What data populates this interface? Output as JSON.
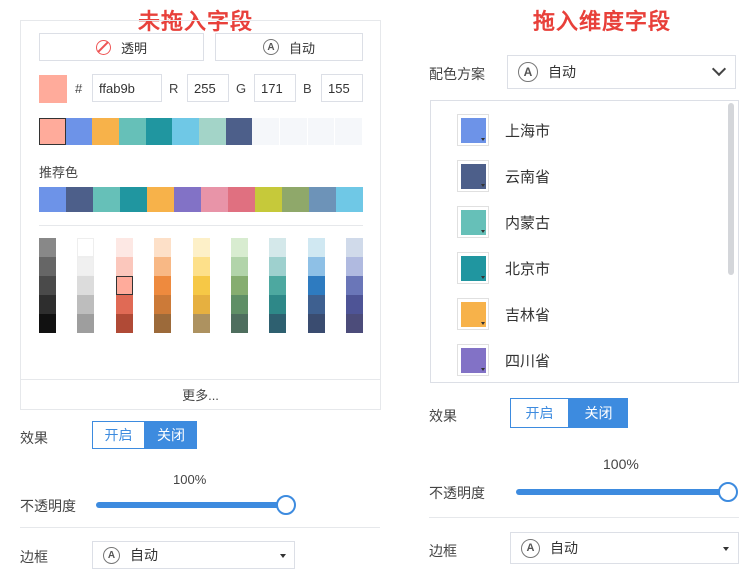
{
  "titles": {
    "left": "未拖入字段",
    "right": "拖入维度字段"
  },
  "left": {
    "transparent_label": "透明",
    "auto_label": "自动",
    "auto_icon_char": "A",
    "hex_prefix": "#",
    "hex_value": "ffab9b",
    "r_label": "R",
    "r_value": "255",
    "g_label": "G",
    "g_value": "171",
    "b_label": "B",
    "b_value": "155",
    "current_color": "#ffab9b",
    "recent_colors": [
      "#ffab9b",
      "#6d93e8",
      "#f7b24a",
      "#66c0b8",
      "#2096a0",
      "#6fc8e6",
      "#a3d4c8",
      "#4d5f8a",
      "#f5f7fa",
      "#f5f7fa",
      "#f5f7fa",
      "#f5f7fa"
    ],
    "recommended_label": "推荐色",
    "recommended_colors": [
      "#6d93e8",
      "#4d5f8a",
      "#66c0b8",
      "#2096a0",
      "#f7b24a",
      "#8272c6",
      "#e894a8",
      "#e07080",
      "#c6c93a",
      "#8fa86a",
      "#6d93b8",
      "#6fc8e6"
    ],
    "palette_columns": [
      [
        "#888888",
        "#666666",
        "#4a4a4a",
        "#2e2e2e",
        "#111111"
      ],
      [
        "#ffffff",
        "#f0f0f0",
        "#dcdcdc",
        "#bdbdbd",
        "#9e9e9e"
      ],
      [
        "#fde8e4",
        "#fbc7bc",
        "#ffab9b",
        "#e06a55",
        "#b04a36"
      ],
      [
        "#fde0c8",
        "#f8b885",
        "#ee8a3e",
        "#cc7a38",
        "#9c6a3a"
      ],
      [
        "#fdf0c8",
        "#fde08a",
        "#f6c846",
        "#e6b040",
        "#ad9260"
      ],
      [
        "#d8ecd0",
        "#b2d4aa",
        "#86ad70",
        "#5f8f66",
        "#4e6e5e"
      ],
      [
        "#d4e8ea",
        "#9ed0ce",
        "#4da8a0",
        "#2e8888",
        "#2e6070"
      ],
      [
        "#d0e8f2",
        "#8ec0e6",
        "#2e7bc0",
        "#3e6090",
        "#3a4c70"
      ],
      [
        "#d0daea",
        "#b0bae0",
        "#6a76b8",
        "#4e5496",
        "#4c4c7a"
      ]
    ],
    "more_label": "更多...",
    "effect_label": "效果",
    "effect_on": "开启",
    "effect_off": "关闭",
    "opacity_value": "100%",
    "opacity_label": "不透明度",
    "opacity_fraction": 1.0,
    "border_label": "边框",
    "border_value": "自动",
    "accent_color": "#3d8bdf"
  },
  "right": {
    "scheme_label": "配色方案",
    "scheme_value": "自动",
    "items": [
      {
        "label": "上海市",
        "color": "#6d93e8"
      },
      {
        "label": "云南省",
        "color": "#4d5f8a"
      },
      {
        "label": "内蒙古",
        "color": "#66c0b8"
      },
      {
        "label": "北京市",
        "color": "#2096a0"
      },
      {
        "label": "吉林省",
        "color": "#f7b24a"
      },
      {
        "label": "四川省",
        "color": "#8272c6"
      }
    ],
    "effect_label": "效果",
    "effect_on": "开启",
    "effect_off": "关闭",
    "opacity_value": "100%",
    "opacity_label": "不透明度",
    "opacity_fraction": 1.0,
    "border_label": "边框",
    "border_value": "自动"
  }
}
